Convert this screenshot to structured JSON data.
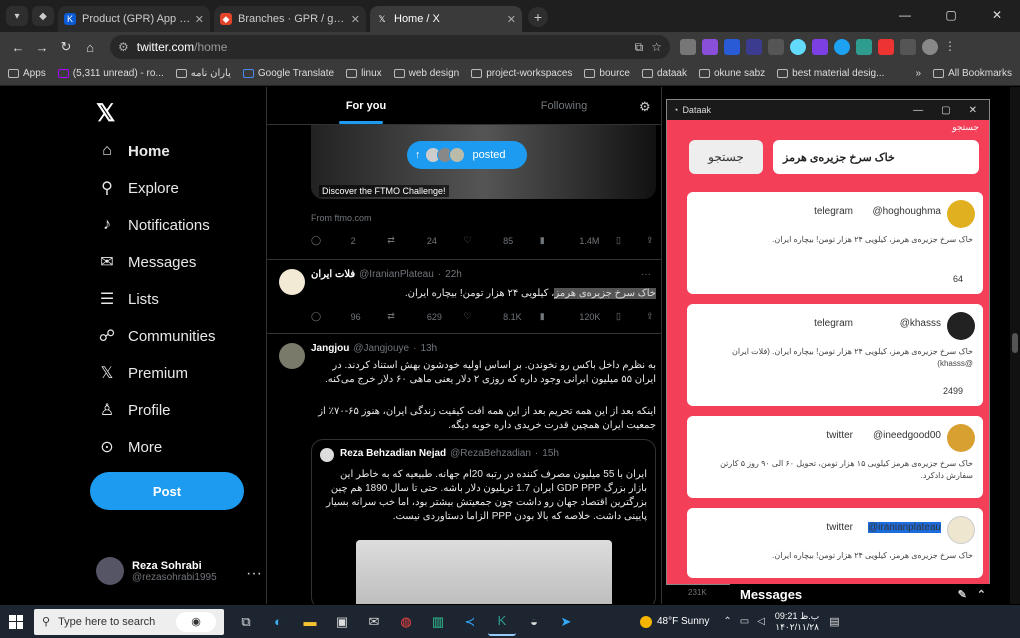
{
  "browser": {
    "tabs": [
      {
        "title": "Product (GPR) App Scrum Boa",
        "active": false
      },
      {
        "title": "Branches · GPR / gpr-extensio",
        "active": false
      },
      {
        "title": "Home / X",
        "active": true
      }
    ],
    "url_host": "twitter.com",
    "url_path": "/home",
    "bookmarks": [
      "Apps",
      "(5,311 unread) - ro...",
      "یاران نامه",
      "Google Translate",
      "linux",
      "web design",
      "project-workspaces",
      "bource",
      "dataak",
      "okune sabz",
      "best material desig..."
    ],
    "all_bookmarks": "All Bookmarks"
  },
  "sidebar": {
    "items": [
      {
        "label": "Home",
        "icon": "home-icon"
      },
      {
        "label": "Explore",
        "icon": "search-icon"
      },
      {
        "label": "Notifications",
        "icon": "bell-icon"
      },
      {
        "label": "Messages",
        "icon": "envelope-icon"
      },
      {
        "label": "Lists",
        "icon": "list-icon"
      },
      {
        "label": "Communities",
        "icon": "people-icon"
      },
      {
        "label": "Premium",
        "icon": "x-logo-icon"
      },
      {
        "label": "Profile",
        "icon": "person-icon"
      },
      {
        "label": "More",
        "icon": "more-circle-icon"
      }
    ],
    "post_label": "Post",
    "user_name": "Reza Sohrabi",
    "user_handle": "@rezasohrabi1995"
  },
  "timeline": {
    "tabs": [
      "For you",
      "Following"
    ],
    "posted_label": "posted",
    "ad_caption": "Discover the FTMO Challenge!",
    "from_line": "From ftmo.com",
    "ad_actions": [
      "2",
      "24",
      "85",
      "1.4M"
    ],
    "tweet1": {
      "name": "فلات ایران",
      "handle": "@IranianPlateau",
      "time": "22h",
      "text_hl": "خاک سرخ جزیره‌ی هرمز",
      "text_rest": "، کیلویی ۲۴ هزار تومن! بیچاره ایران.",
      "actions": [
        "96",
        "629",
        "8.1K",
        "120K"
      ]
    },
    "tweet2": {
      "name": "Jangjou",
      "handle": "@Jangjouye",
      "time": "13h",
      "p1": "به نظرم داخل باکس رو نخوندن. بر اساس اولیه خودشون بهش استناد کردند. در ایران ۵۵ میلیون ایرانی وجود داره که روزی ۲ دلار یعنی ماهی ۶۰ دلار خرج می‌کنه.",
      "p2": "اینکه بعد از این همه تحریم بعد از این همه افت کیفیت زندگی ایران، هنوز ۶۵-۷۰٪ از جمعیت ایران همچین قدرت خریدی داره خوبه دیگه."
    },
    "quote": {
      "name": "Reza Behzadian Nejad",
      "handle": "@RezaBehzadian",
      "time": "15h",
      "text": "ایران با 55 میلیون مصرف کننده در رتبه 20ام جهانه. طبیعیه که به خاطر این بازار بزرگ GDP PPP ایران 1.7 تریلیون دلار باشه. حتی تا سال 1890 هم چین بزرگترین اقتصاد جهان رو داشت چون جمعیتش بیشتر بود، اما خب سرانه بسیار پایینی داشت. خلاصه که بالا بودن PPP الزاما دستاوردی نیست."
    }
  },
  "popup": {
    "title": "Dataak",
    "label": "جستجو",
    "search_button": "جستجو",
    "search_value": "خاک سرخ جزیره‌ی هرمز",
    "cards": [
      {
        "handle": "@hoghoughma",
        "source": "telegram",
        "text": "خاک سرخ جزیره‌ی هرمز، کیلویی ۲۴ هزار تومن! بیچاره ایران.",
        "count": "64",
        "avatar_color": "#e0b020"
      },
      {
        "handle": "@khasss",
        "source": "telegram",
        "text": "خاک سرخ جزیره‌ی هرمز، کیلویی ۲۴ هزار تومن! بیچاره ایران. (فلات ایران @khasss)",
        "count": "2499",
        "avatar_color": "#222222"
      },
      {
        "handle": "@ineedgood00",
        "source": "twitter",
        "text": "خاک سرخ جزیره‌ی هرمز کیلویی ۱۵ هزار تومن، تحویل ۶۰ الی ۹۰ روز ۵ کارتن سفارش دادکرد.",
        "count": "",
        "avatar_color": "#d8a030"
      },
      {
        "handle": "@iranianplateau",
        "source": "twitter",
        "text": "خاک سرخ جزیره‌ی هرمز، کیلویی ۲۴ هزار تومن! بیچاره ایران.",
        "count": "",
        "avatar_color": "#efe6d0"
      }
    ]
  },
  "messages_label": "Messages",
  "partial_count": "231K",
  "taskbar": {
    "search_placeholder": "Type here to search",
    "weather": "48°F Sunny",
    "time": "09:21 ب.ظ",
    "date": "۱۴۰۲/۱۱/۲۸"
  }
}
